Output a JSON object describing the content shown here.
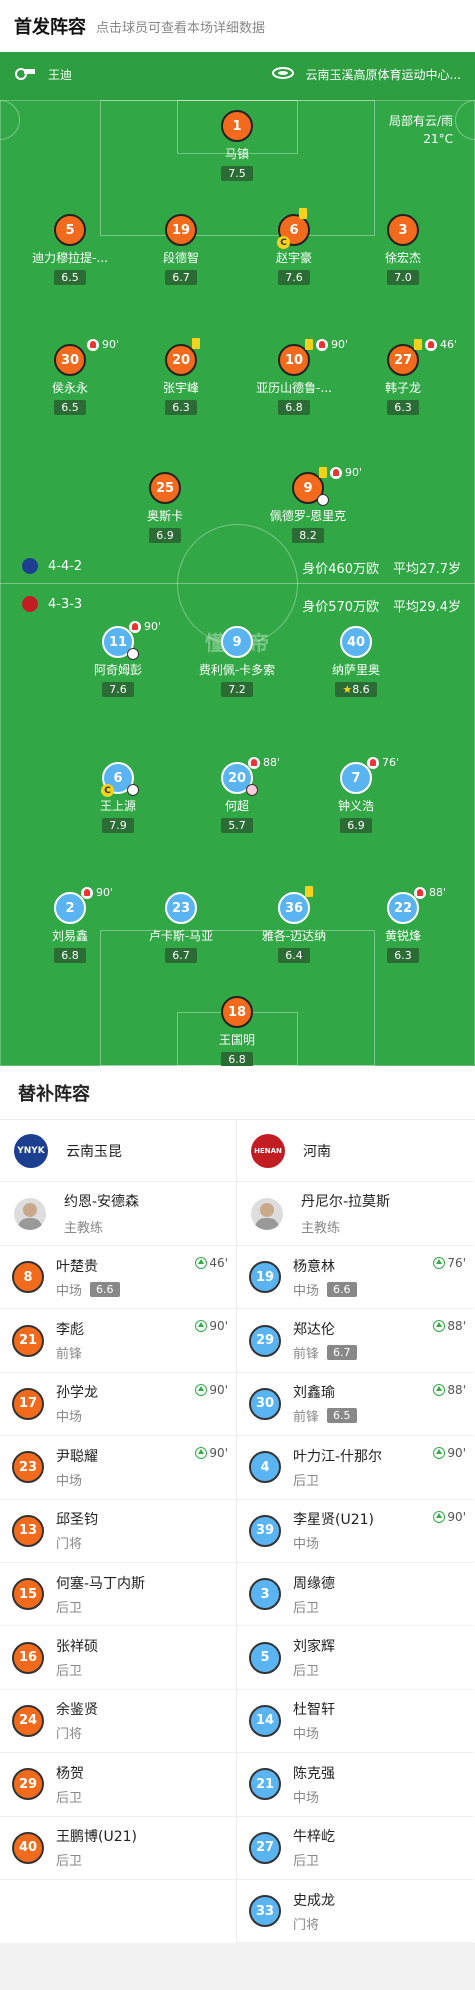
{
  "header": {
    "title": "首发阵容",
    "subtitle": "点击球员可查看本场详细数据"
  },
  "pitch": {
    "referee": "王迪",
    "venue": "云南玉溪高原体育运动中心...",
    "weather": "局部有云/雨",
    "temperature": "21°C",
    "watermark": "懂球帝",
    "home": {
      "formation": "4-4-2",
      "value": "身价460万欧",
      "age": "平均27.7岁"
    },
    "away": {
      "formation": "4-3-3",
      "value": "身价570万欧",
      "age": "平均29.4岁"
    }
  },
  "home_players": [
    {
      "num": "1",
      "name": "马镇",
      "rating": "7.5"
    },
    {
      "num": "5",
      "name": "迪力穆拉提-...",
      "rating": "6.5"
    },
    {
      "num": "19",
      "name": "段德智",
      "rating": "6.7"
    },
    {
      "num": "6",
      "name": "赵宇豪",
      "rating": "7.6",
      "captain": "C"
    },
    {
      "num": "3",
      "name": "徐宏杰",
      "rating": "7.0"
    },
    {
      "num": "30",
      "name": "侯永永",
      "rating": "6.5",
      "sub": "90'"
    },
    {
      "num": "20",
      "name": "张宇峰",
      "rating": "6.3"
    },
    {
      "num": "10",
      "name": "亚历山德鲁-...",
      "rating": "6.8",
      "sub": "90'"
    },
    {
      "num": "27",
      "name": "韩子龙",
      "rating": "6.3",
      "sub": "46'"
    },
    {
      "num": "25",
      "name": "奥斯卡",
      "rating": "6.9"
    },
    {
      "num": "9",
      "name": "佩德罗-恩里克",
      "rating": "8.2",
      "sub": "90'"
    }
  ],
  "away_players": [
    {
      "num": "11",
      "name": "阿奇姆彭",
      "rating": "7.6",
      "sub": "90'"
    },
    {
      "num": "9",
      "name": "费利佩-卡多索",
      "rating": "7.2"
    },
    {
      "num": "40",
      "name": "纳萨里奥",
      "rating": "8.6"
    },
    {
      "num": "6",
      "name": "王上源",
      "rating": "7.9",
      "captain": "C"
    },
    {
      "num": "20",
      "name": "何超",
      "rating": "5.7",
      "sub": "88'"
    },
    {
      "num": "7",
      "name": "钟义浩",
      "rating": "6.9",
      "sub": "76'"
    },
    {
      "num": "2",
      "name": "刘易鑫",
      "rating": "6.8",
      "sub": "90'"
    },
    {
      "num": "23",
      "name": "卢卡斯-马亚",
      "rating": "6.7"
    },
    {
      "num": "36",
      "name": "雅各-迈达纳",
      "rating": "6.4"
    },
    {
      "num": "22",
      "name": "黄锐烽",
      "rating": "6.3",
      "sub": "88'"
    },
    {
      "num": "18",
      "name": "王国明",
      "rating": "6.8"
    }
  ],
  "subs": {
    "title": "替补阵容",
    "home": {
      "team": "云南玉昆",
      "logo_text": "YNYK",
      "coach": "约恩-安德森",
      "coach_role": "主教练",
      "players": [
        {
          "num": "8",
          "name": "叶楚贵",
          "pos": "中场",
          "rating": "6.6",
          "in": "46'"
        },
        {
          "num": "21",
          "name": "李彪",
          "pos": "前锋",
          "rating": "",
          "in": "90'"
        },
        {
          "num": "17",
          "name": "孙学龙",
          "pos": "中场",
          "rating": "",
          "in": "90'"
        },
        {
          "num": "23",
          "name": "尹聪耀",
          "pos": "中场",
          "rating": "",
          "in": "90'"
        },
        {
          "num": "13",
          "name": "邱圣钧",
          "pos": "门将",
          "rating": "",
          "in": ""
        },
        {
          "num": "15",
          "name": "何塞-马丁内斯",
          "pos": "后卫",
          "rating": "",
          "in": ""
        },
        {
          "num": "16",
          "name": "张祥硕",
          "pos": "后卫",
          "rating": "",
          "in": ""
        },
        {
          "num": "24",
          "name": "余鉴贤",
          "pos": "门将",
          "rating": "",
          "in": ""
        },
        {
          "num": "29",
          "name": "杨贺",
          "pos": "后卫",
          "rating": "",
          "in": ""
        },
        {
          "num": "40",
          "name": "王鹏博(U21)",
          "pos": "后卫",
          "rating": "",
          "in": ""
        }
      ]
    },
    "away": {
      "team": "河南",
      "logo_text": "HENAN",
      "coach": "丹尼尔-拉莫斯",
      "coach_role": "主教练",
      "players": [
        {
          "num": "19",
          "name": "杨意林",
          "pos": "中场",
          "rating": "6.6",
          "in": "76'"
        },
        {
          "num": "29",
          "name": "郑达伦",
          "pos": "前锋",
          "rating": "6.7",
          "in": "88'"
        },
        {
          "num": "30",
          "name": "刘鑫瑜",
          "pos": "前锋",
          "rating": "6.5",
          "in": "88'"
        },
        {
          "num": "4",
          "name": "叶力江-什那尔",
          "pos": "后卫",
          "rating": "",
          "in": "90'"
        },
        {
          "num": "39",
          "name": "李星贤(U21)",
          "pos": "中场",
          "rating": "",
          "in": "90'"
        },
        {
          "num": "3",
          "name": "周缘德",
          "pos": "后卫",
          "rating": "",
          "in": ""
        },
        {
          "num": "5",
          "name": "刘家辉",
          "pos": "后卫",
          "rating": "",
          "in": ""
        },
        {
          "num": "14",
          "name": "杜智轩",
          "pos": "中场",
          "rating": "",
          "in": ""
        },
        {
          "num": "21",
          "name": "陈克强",
          "pos": "中场",
          "rating": "",
          "in": ""
        },
        {
          "num": "27",
          "name": "牛梓屹",
          "pos": "后卫",
          "rating": "",
          "in": ""
        },
        {
          "num": "33",
          "name": "史成龙",
          "pos": "门将",
          "rating": "",
          "in": ""
        }
      ]
    }
  }
}
